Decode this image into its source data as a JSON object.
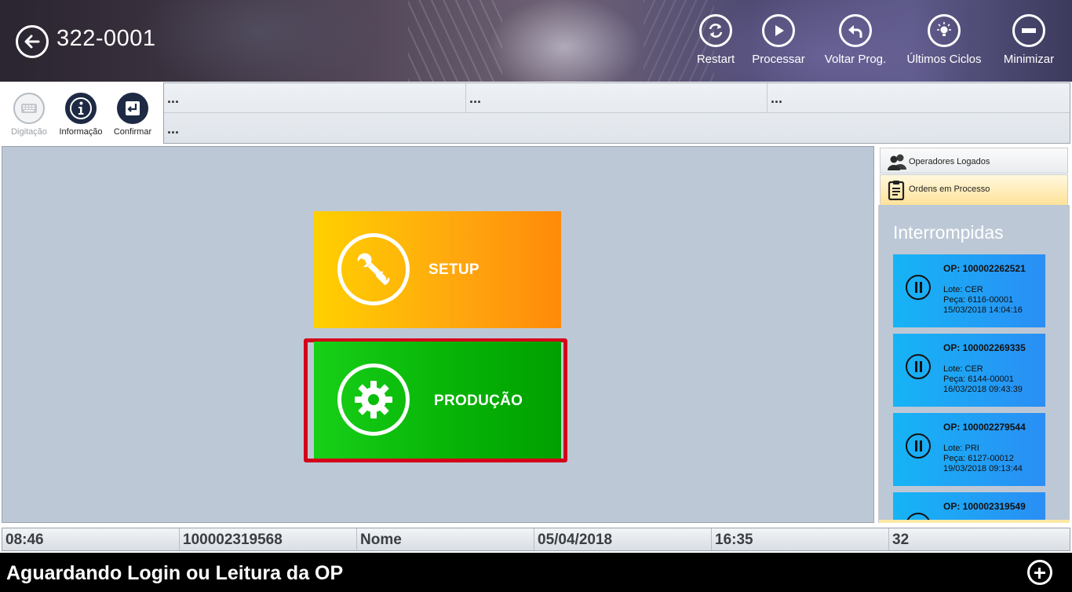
{
  "header": {
    "title": "322-0001",
    "actions": [
      {
        "label": "Restart",
        "icon": "refresh-icon"
      },
      {
        "label": "Processar",
        "icon": "play-icon"
      },
      {
        "label": "Voltar Prog.",
        "icon": "undo-icon"
      },
      {
        "label": "Últimos Ciclos",
        "icon": "lightbulb-icon"
      },
      {
        "label": "Minimizar",
        "icon": "minus-icon"
      }
    ]
  },
  "toolbar": {
    "buttons": [
      {
        "label": "Digitação",
        "icon": "keyboard-icon",
        "enabled": false
      },
      {
        "label": "Informação",
        "icon": "info-icon",
        "enabled": true
      },
      {
        "label": "Confirmar",
        "icon": "enter-icon",
        "enabled": true
      }
    ]
  },
  "info_grid": {
    "row1": [
      "...",
      "...",
      "..."
    ],
    "row2": [
      "..."
    ]
  },
  "main": {
    "setup_label": "SETUP",
    "producao_label": "PRODUÇÃO"
  },
  "side": {
    "tabs": [
      {
        "label": "Operadores Logados",
        "icon": "users-icon"
      },
      {
        "label": "Ordens em Processo",
        "icon": "clipboard-icon"
      }
    ],
    "section_title": "Interrompidas",
    "orders": [
      {
        "op": "OP: 100002262521",
        "lote": "Lote: CER",
        "peca": "Peça: 6116-00001",
        "datetime": "15/03/2018 14:04:16"
      },
      {
        "op": "OP: 100002269335",
        "lote": "Lote: CER",
        "peca": "Peça: 6144-00001",
        "datetime": "16/03/2018 09:43:39"
      },
      {
        "op": "OP: 100002279544",
        "lote": "Lote: PRI",
        "peca": "Peça: 6127-00012",
        "datetime": "19/03/2018 09:13:44"
      },
      {
        "op": "OP: 100002319549",
        "lote": "",
        "peca": "",
        "datetime": ""
      }
    ]
  },
  "status_bar": [
    "08:46",
    "100002319568",
    "Nome",
    "05/04/2018",
    "16:35",
    "32"
  ],
  "message": "Aguardando Login ou Leitura da OP",
  "colors": {
    "setup_start": "#ffd000",
    "setup_end": "#ff8a0a",
    "producao_start": "#18d018",
    "producao_end": "#00a000",
    "highlight": "#d4001a",
    "order_card": "#2a8ef5",
    "panel_bg": "#bdc8d6"
  }
}
